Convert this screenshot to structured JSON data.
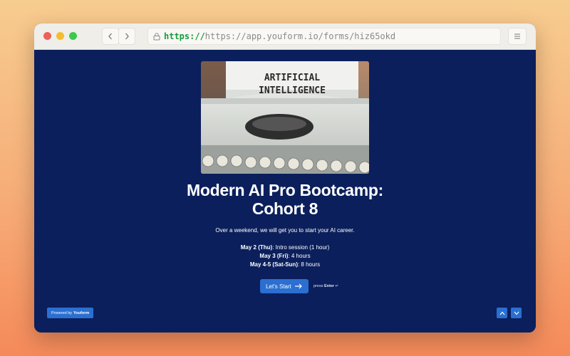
{
  "browser": {
    "url_scheme": "https://",
    "url_rest": "https://app.youform.io/forms/hiz65okd"
  },
  "form": {
    "hero_text_line1": "ARTIFICIAL",
    "hero_text_line2": "INTELLIGENCE",
    "title_line1": "Modern AI Pro Bootcamp:",
    "title_line2": "Cohort 8",
    "description": "Over a weekend, we will get you to start your AI career.",
    "schedule": [
      {
        "day": "May 2 (Thu)",
        "detail": ": Intro session (1 hour)"
      },
      {
        "day": "May 3 (Fri)",
        "detail": ": 4 hours"
      },
      {
        "day": "May 4-5 (Sat-Sun)",
        "detail": ": 8 hours"
      }
    ],
    "start_button_label": "Let's Start",
    "hint_prefix": "press",
    "hint_key": "Enter",
    "hint_glyph": "↵"
  },
  "footer": {
    "powered_prefix": "Powered by",
    "powered_brand": "Youform"
  },
  "icons": {
    "back": "chevron-left-icon",
    "forward": "chevron-right-icon",
    "lock": "lock-icon",
    "menu": "hamburger-icon",
    "arrow": "arrow-right-icon",
    "up": "chevron-up-icon",
    "down": "chevron-down-icon"
  },
  "colors": {
    "page_background": "#0b1f5c",
    "accent": "#2b6fd1",
    "url_scheme": "#1a9a3d"
  }
}
